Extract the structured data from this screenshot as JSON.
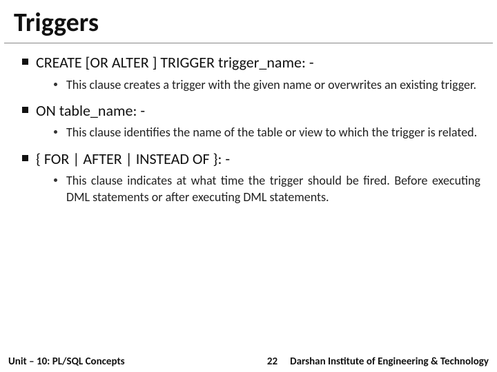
{
  "title": "Triggers",
  "items": [
    {
      "heading": "CREATE [OR ALTER ] TRIGGER trigger_name: -",
      "sub": "This clause creates a trigger with the given name or overwrites an existing trigger."
    },
    {
      "heading": "ON table_name: -",
      "sub": "This clause identifies the name of the table or view to which the trigger is related."
    },
    {
      "heading": "{ FOR | AFTER | INSTEAD OF }: -",
      "sub": "This clause indicates at what time the trigger should be fired. Before executing DML statements or after executing DML statements."
    }
  ],
  "footer": {
    "unit": "Unit – 10: PL/SQL Concepts",
    "page": "22",
    "institute": "Darshan Institute of Engineering & Technology"
  }
}
